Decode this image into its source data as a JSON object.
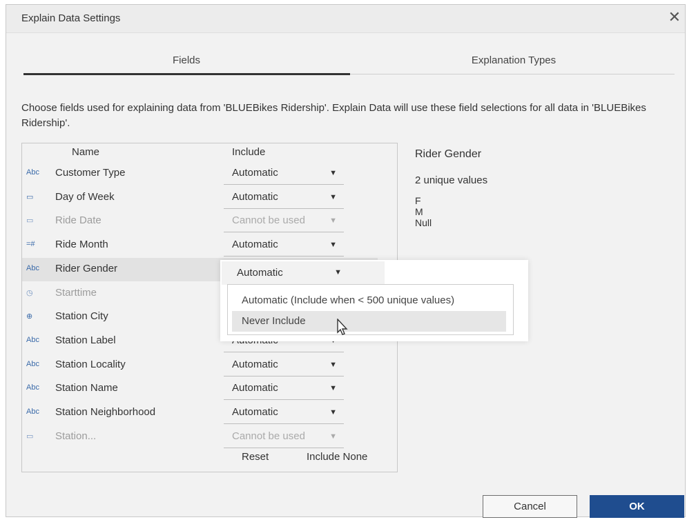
{
  "window": {
    "title": "Explain Data Settings",
    "close_glyph": "✕"
  },
  "tabs": [
    {
      "label": "Fields",
      "active": true
    },
    {
      "label": "Explanation Types",
      "active": false
    }
  ],
  "description": "Choose fields used for explaining data from 'BLUEBikes Ridership'. Explain Data will use these field selections for all data in 'BLUEBikes Ridership'.",
  "table": {
    "headers": {
      "name": "Name",
      "include": "Include"
    },
    "rows": [
      {
        "icon": "Abc",
        "icon_name": "string-type-icon",
        "name": "Customer Type",
        "include": "Automatic",
        "disabled": false
      },
      {
        "icon": "▭",
        "icon_name": "date-type-icon",
        "name": "Day of Week",
        "include": "Automatic",
        "disabled": false
      },
      {
        "icon": "▭",
        "icon_name": "date-type-icon",
        "name": "Ride Date",
        "include": "Cannot be used",
        "disabled": true
      },
      {
        "icon": "=#",
        "icon_name": "number-type-icon",
        "name": "Ride Month",
        "include": "Automatic",
        "disabled": false
      },
      {
        "icon": "Abc",
        "icon_name": "string-type-icon",
        "name": "Rider Gender",
        "include": "Automatic",
        "disabled": false,
        "selected": true
      },
      {
        "icon": "◷",
        "icon_name": "datetime-type-icon",
        "name": "Starttime",
        "include": "",
        "disabled": true
      },
      {
        "icon": "⊕",
        "icon_name": "geo-type-icon",
        "name": "Station City",
        "include": "",
        "disabled": false
      },
      {
        "icon": "Abc",
        "icon_name": "string-type-icon",
        "name": "Station Label",
        "include": "Automatic",
        "disabled": false
      },
      {
        "icon": "Abc",
        "icon_name": "string-type-icon",
        "name": "Station Locality",
        "include": "Automatic",
        "disabled": false
      },
      {
        "icon": "Abc",
        "icon_name": "string-type-icon",
        "name": "Station Name",
        "include": "Automatic",
        "disabled": false
      },
      {
        "icon": "Abc",
        "icon_name": "string-type-icon",
        "name": "Station Neighborhood",
        "include": "Automatic",
        "disabled": false
      },
      {
        "icon": "▭",
        "icon_name": "date-type-icon",
        "name": "Station...",
        "include": "Cannot be used",
        "disabled": true
      }
    ],
    "reset_label": "Reset",
    "include_none_label": "Include None"
  },
  "dropdown_menu": {
    "current": "Automatic",
    "items": [
      {
        "label": "Automatic (Include when < 500 unique values)",
        "highlighted": false
      },
      {
        "label": "Never Include",
        "highlighted": true
      }
    ]
  },
  "details": {
    "field": "Rider Gender",
    "unique_count": "2 unique values",
    "values": [
      "F",
      "M",
      "Null"
    ]
  },
  "buttons": {
    "cancel": "Cancel",
    "ok": "OK"
  },
  "colors": {
    "ok_button": "#1f4d8f",
    "icon_blue": "#3a6aa9",
    "tab_underline": "#333333"
  }
}
